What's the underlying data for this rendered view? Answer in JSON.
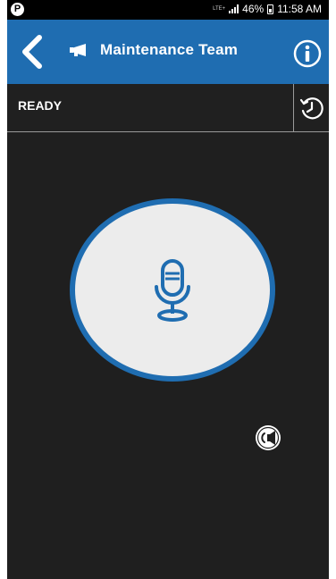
{
  "status_bar": {
    "left_icon": "parking-p-icon",
    "network": "LTE+",
    "battery": "46%",
    "time": "11:58 AM"
  },
  "app_bar": {
    "title": "Maintenance Team",
    "back_icon": "back-chevron-icon",
    "group_icon": "megaphone-icon",
    "info_icon": "info-icon",
    "brand_color": "#1f6db1"
  },
  "status_strip": {
    "state": "READY",
    "history_icon": "history-clock-icon"
  },
  "ptt": {
    "icon": "microphone-icon",
    "ring_color": "#1f6db1"
  },
  "speaker_toggle": {
    "icon": "speaker-icon"
  }
}
